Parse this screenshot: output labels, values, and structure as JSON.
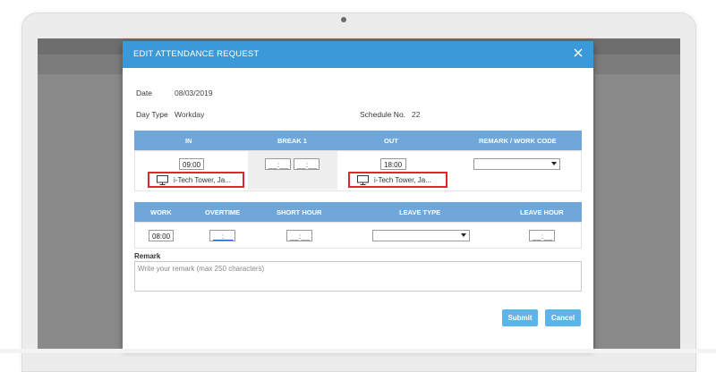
{
  "modal": {
    "title": "EDIT ATTENDANCE REQUEST",
    "date_label": "Date",
    "date_value": "08/03/2019",
    "day_type_label": "Day Type",
    "day_type_value": "Workday",
    "schedule_label": "Schedule No.",
    "schedule_value": "22"
  },
  "times_table": {
    "headers": [
      "IN",
      "BREAK 1",
      "OUT",
      "REMARK / WORK CODE"
    ],
    "in_value": "09:00",
    "break_start": "__:__",
    "break_end": "__:__",
    "out_value": "18:00",
    "in_location": "i-Tech Tower, Ja...",
    "out_location": "i-Tech Tower, Ja...",
    "remark_code_selected": ""
  },
  "hours_table": {
    "headers": [
      "WORK",
      "OVERTIME",
      "SHORT HOUR",
      "LEAVE TYPE",
      "LEAVE HOUR"
    ],
    "work_value": "08:00",
    "overtime_value": "__:__",
    "short_hour_value": "__:__",
    "leave_type_selected": "",
    "leave_hour_value": "__:__"
  },
  "remark": {
    "label": "Remark",
    "placeholder": "Write your remark (max 250 characters)"
  },
  "buttons": {
    "submit": "Submit",
    "cancel": "Cancel"
  },
  "colors": {
    "header_blue": "#3a99d8",
    "table_header_blue": "#6fa7d8",
    "button_blue": "#5cb5e8",
    "highlight_red": "#e0262f"
  }
}
